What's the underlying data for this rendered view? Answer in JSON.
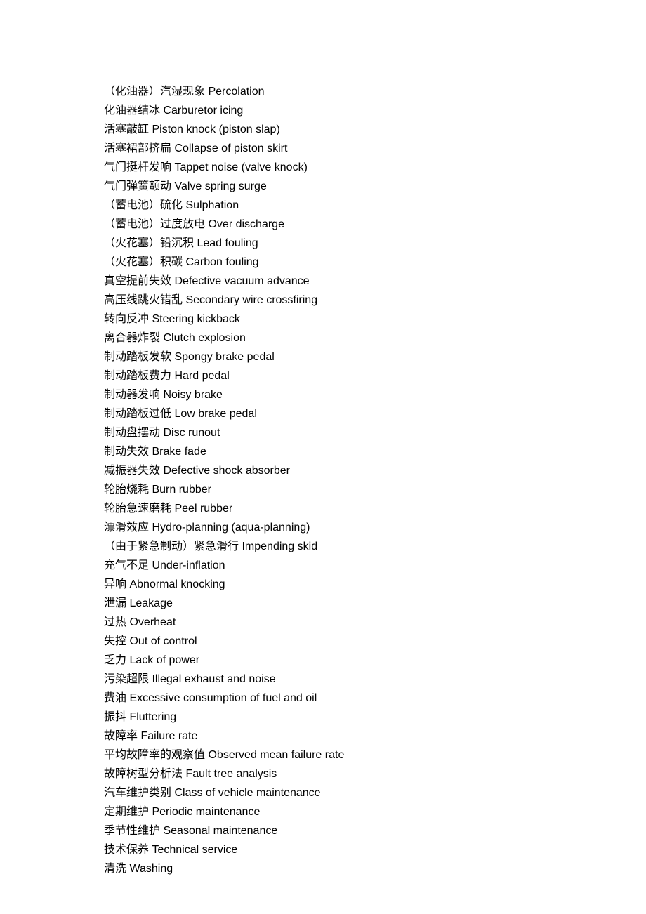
{
  "terms": [
    {
      "zh": "（化油器）汽湿现象",
      "en": "Percolation"
    },
    {
      "zh": "化油器结冰",
      "en": "Carburetor icing"
    },
    {
      "zh": "活塞敲缸",
      "en": "Piston knock (piston slap)"
    },
    {
      "zh": "活塞裙部挤扁",
      "en": "Collapse of piston skirt"
    },
    {
      "zh": "气门挺杆发响",
      "en": "Tappet noise (valve knock)"
    },
    {
      "zh": "气门弹簧颤动",
      "en": "Valve spring surge"
    },
    {
      "zh": "（蓄电池）硫化",
      "en": "Sulphation"
    },
    {
      "zh": "（蓄电池）过度放电",
      "en": "Over discharge"
    },
    {
      "zh": "（火花塞）铅沉积",
      "en": "Lead fouling"
    },
    {
      "zh": "（火花塞）积碳",
      "en": "Carbon fouling"
    },
    {
      "zh": "真空提前失效",
      "en": "Defective vacuum advance"
    },
    {
      "zh": "高压线跳火错乱",
      "en": "Secondary wire crossfiring"
    },
    {
      "zh": "转向反冲",
      "en": "Steering kickback"
    },
    {
      "zh": "离合器炸裂",
      "en": "Clutch explosion"
    },
    {
      "zh": "制动踏板发软",
      "en": "Spongy brake pedal"
    },
    {
      "zh": "制动踏板费力",
      "en": "Hard pedal"
    },
    {
      "zh": "制动器发响",
      "en": "Noisy brake"
    },
    {
      "zh": "制动踏板过低",
      "en": "Low brake pedal"
    },
    {
      "zh": "制动盘摆动",
      "en": "Disc runout"
    },
    {
      "zh": "制动失效",
      "en": "Brake fade"
    },
    {
      "zh": "减振器失效",
      "en": "Defective shock absorber"
    },
    {
      "zh": "轮胎烧耗",
      "en": "Burn rubber"
    },
    {
      "zh": "轮胎急速磨耗",
      "en": "Peel rubber"
    },
    {
      "zh": "漂滑效应",
      "en": "Hydro-planning (aqua-planning)"
    },
    {
      "zh": "（由于紧急制动）紧急滑行",
      "en": "Impending skid"
    },
    {
      "zh": "充气不足",
      "en": "Under-inflation"
    },
    {
      "zh": "异响",
      "en": "Abnormal knocking"
    },
    {
      "zh": "泄漏",
      "en": "Leakage"
    },
    {
      "zh": "过热",
      "en": "Overheat"
    },
    {
      "zh": "失控",
      "en": "Out of control"
    },
    {
      "zh": "乏力",
      "en": "Lack of power"
    },
    {
      "zh": "污染超限",
      "en": "Illegal exhaust and noise"
    },
    {
      "zh": "费油",
      "en": "Excessive consumption of fuel and oil"
    },
    {
      "zh": "振抖",
      "en": "Fluttering"
    },
    {
      "zh": "故障率",
      "en": "Failure rate"
    },
    {
      "zh": "平均故障率的观察值",
      "en": "Observed mean failure rate"
    },
    {
      "zh": "故障树型分析法",
      "en": "Fault tree analysis"
    },
    {
      "zh": "汽车维护类别",
      "en": "Class of vehicle maintenance"
    },
    {
      "zh": "定期维护",
      "en": "Periodic maintenance"
    },
    {
      "zh": "季节性维护",
      "en": "Seasonal maintenance"
    },
    {
      "zh": "技术保养",
      "en": "Technical service"
    },
    {
      "zh": "清洗",
      "en": "Washing"
    }
  ]
}
